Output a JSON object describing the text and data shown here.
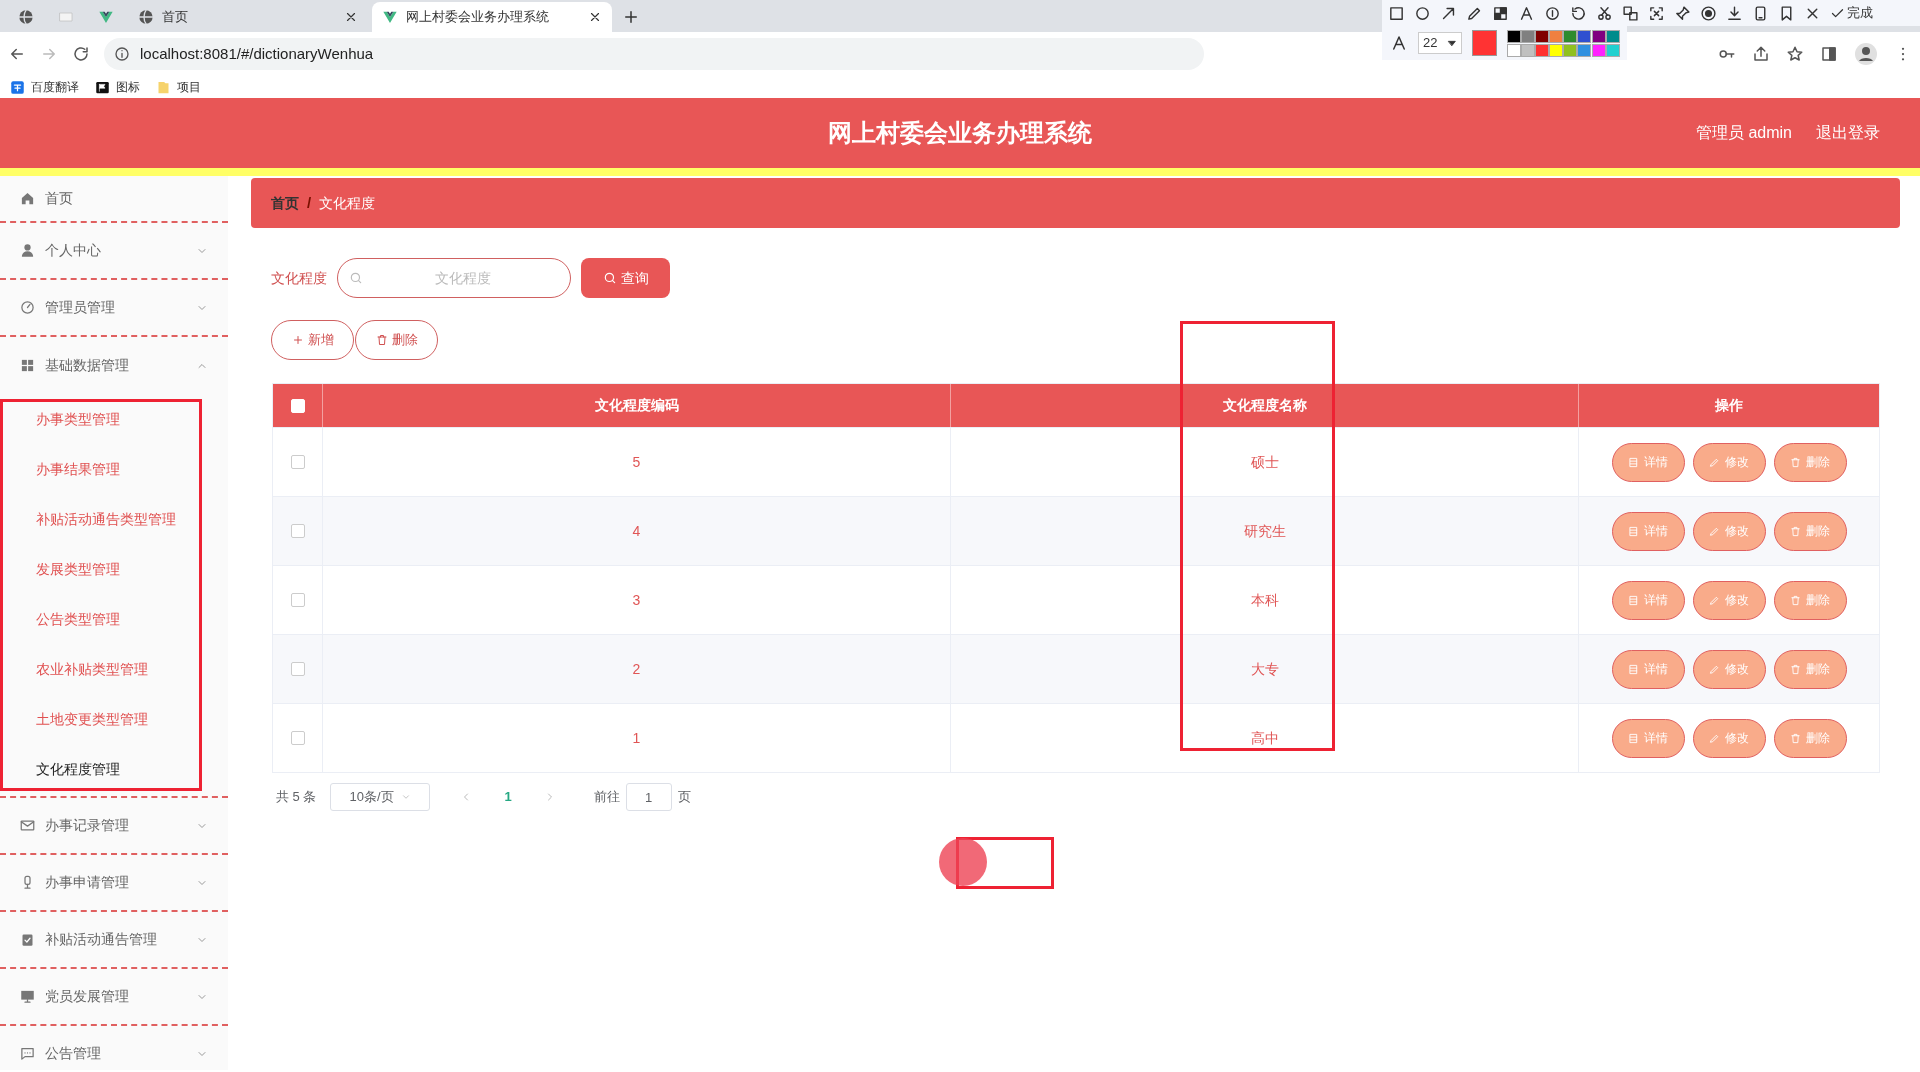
{
  "browser": {
    "tabs": [
      {
        "kind": "globe",
        "selected": false
      },
      {
        "kind": "blank",
        "selected": false
      },
      {
        "kind": "vue",
        "selected": false
      },
      {
        "kind": "globe",
        "title": "首页",
        "selected": false
      },
      {
        "kind": "vue",
        "title": "网上村委会业务办理系统",
        "selected": true
      }
    ],
    "url": "localhost:8081/#/dictionaryWenhua",
    "bookmarks": [
      {
        "kind": "translate",
        "label": "百度翻译"
      },
      {
        "kind": "flag",
        "label": "图标"
      },
      {
        "kind": "folder",
        "label": "项目"
      }
    ]
  },
  "capture_toolbar": {
    "font_size": "22",
    "done": "完成",
    "palette": [
      {
        "color": "#000000"
      },
      {
        "color": "#808080"
      },
      {
        "color": "#800000"
      },
      {
        "color": "#f08040"
      },
      {
        "color": "#2e8b2e"
      },
      {
        "color": "#3050d0"
      },
      {
        "color": "#800080"
      },
      {
        "color": "#008b8b"
      },
      {
        "color": "#ffffff"
      },
      {
        "color": "#c0c0c0"
      },
      {
        "color": "#ff3030"
      },
      {
        "color": "#ffff00"
      },
      {
        "color": "#90c020"
      },
      {
        "color": "#3090e0"
      },
      {
        "color": "#ff20ff"
      },
      {
        "color": "#20d0d0"
      }
    ]
  },
  "header": {
    "title": "网上村委会业务办理系统",
    "user": "管理员 admin",
    "logout": "退出登录"
  },
  "sidebar": {
    "items": [
      {
        "kind": "home",
        "label": "首页"
      },
      {
        "kind": "user",
        "label": "个人中心",
        "expanded": false
      },
      {
        "kind": "gauge",
        "label": "管理员管理",
        "expanded": false
      },
      {
        "kind": "grid",
        "label": "基础数据管理",
        "expanded": true,
        "children": [
          {
            "label": "办事类型管理",
            "selected": false
          },
          {
            "label": "办事结果管理",
            "selected": false
          },
          {
            "label": "补贴活动通告类型管理",
            "selected": false
          },
          {
            "label": "发展类型管理",
            "selected": false
          },
          {
            "label": "公告类型管理",
            "selected": false
          },
          {
            "label": "农业补贴类型管理",
            "selected": false
          },
          {
            "label": "土地变更类型管理",
            "selected": false
          },
          {
            "label": "文化程度管理",
            "selected": true
          }
        ]
      },
      {
        "kind": "mail",
        "label": "办事记录管理",
        "expanded": false
      },
      {
        "kind": "mic",
        "label": "办事申请管理",
        "expanded": false
      },
      {
        "kind": "clipboard",
        "label": "补贴活动通告管理",
        "expanded": false
      },
      {
        "kind": "monitor",
        "label": "党员发展管理",
        "expanded": false
      },
      {
        "kind": "chat",
        "label": "公告管理",
        "expanded": false
      }
    ]
  },
  "breadcrumb": {
    "items": [
      "首页",
      "文化程度"
    ],
    "separator": "/"
  },
  "search": {
    "label": "文化程度",
    "placeholder": "文化程度",
    "button": "查询"
  },
  "actions": [
    "新增",
    "删除"
  ],
  "table": {
    "columns": [
      "文化程度编码",
      "文化程度名称",
      "操作"
    ],
    "header_checked": false,
    "rows": [
      {
        "checked": false,
        "code": "5",
        "name": "硕士",
        "actions": [
          "详情",
          "修改",
          "删除"
        ]
      },
      {
        "checked": false,
        "code": "4",
        "name": "研究生",
        "actions": [
          "详情",
          "修改",
          "删除"
        ]
      },
      {
        "checked": false,
        "code": "3",
        "name": "本科",
        "actions": [
          "详情",
          "修改",
          "删除"
        ]
      },
      {
        "checked": false,
        "code": "2",
        "name": "大专",
        "actions": [
          "详情",
          "修改",
          "删除"
        ]
      },
      {
        "checked": false,
        "code": "1",
        "name": "高中",
        "actions": [
          "详情",
          "修改",
          "删除"
        ]
      }
    ]
  },
  "pagination": {
    "total": "共 5 条",
    "page_size": "10条/页",
    "pages": [
      {
        "label": "1",
        "selected": true
      }
    ],
    "goto_label": "前往",
    "goto_value": "1",
    "goto_unit": "页"
  }
}
